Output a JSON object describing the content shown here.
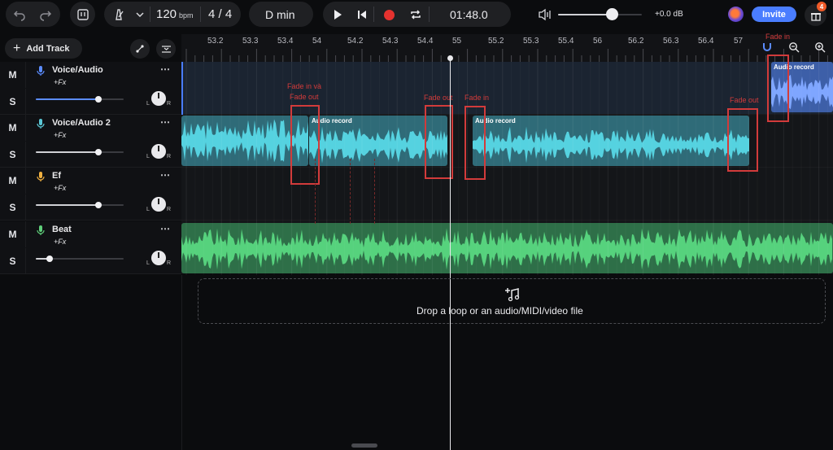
{
  "toolbar": {
    "bpm_value": "120",
    "bpm_unit": "bpm",
    "time_signature": "4 / 4",
    "key": "D min",
    "time": "01:48.0",
    "volume_db": "+0.0 dB",
    "invite_label": "Invite",
    "notification_count": "4"
  },
  "controls": {
    "add_track_label": "Add Track"
  },
  "ruler": {
    "labels": [
      "53.2",
      "53.3",
      "53.4",
      "54",
      "54.2",
      "54.3",
      "54.4",
      "55",
      "55.2",
      "55.3",
      "55.4",
      "56",
      "56.2",
      "56.3",
      "56.4",
      "57"
    ]
  },
  "tracks": [
    {
      "name": "Voice/Audio",
      "fx": "+Fx",
      "mute": "M",
      "solo": "S",
      "pan_l": "L",
      "pan_r": "R",
      "icon": "mic-icon",
      "icon_color": "#5b8cff"
    },
    {
      "name": "Voice/Audio 2",
      "fx": "+Fx",
      "mute": "M",
      "solo": "S",
      "pan_l": "L",
      "pan_r": "R",
      "icon": "mic-icon",
      "icon_color": "#5bc8d6"
    },
    {
      "name": "Ef",
      "fx": "+Fx",
      "mute": "M",
      "solo": "S",
      "pan_l": "L",
      "pan_r": "R",
      "icon": "mic-icon",
      "icon_color": "#f0b040"
    },
    {
      "name": "Beat",
      "fx": "+Fx",
      "mute": "M",
      "solo": "S",
      "pan_l": "L",
      "pan_r": "R",
      "icon": "mic-icon",
      "icon_color": "#5fcf7a"
    }
  ],
  "clips": {
    "clip_title": "Audio record"
  },
  "annotations": {
    "fade_in_and_out_1": "Fade in và",
    "fade_in_and_out_2": "Fade out",
    "fade_out_a": "Fade out",
    "fade_in_a": "Fade in",
    "fade_out_b": "Fade out",
    "fade_in_b": "Fade in"
  },
  "dropzone": {
    "text": "Drop a loop or an audio/MIDI/video file"
  },
  "colors": {
    "accent": "#4a7dff",
    "record": "#e5322f",
    "vocal_clip": "#2f6b78",
    "vocal_wave": "#55d2e0",
    "beat_clip": "#2e6f48",
    "beat_wave": "#56d27d",
    "annotation": "#d23b3b"
  }
}
